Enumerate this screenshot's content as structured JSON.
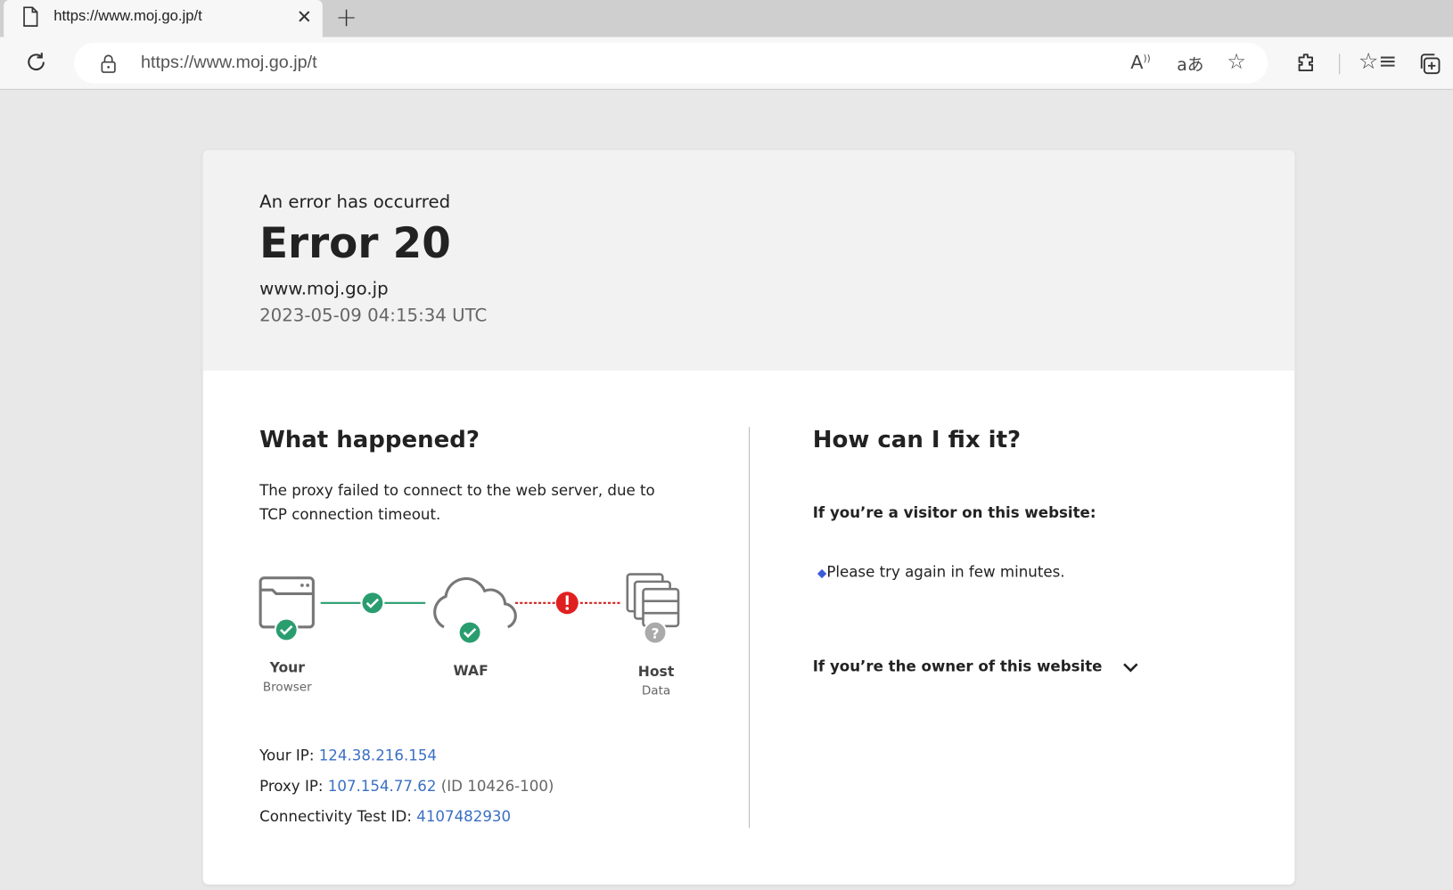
{
  "browser": {
    "tab_title": "https://www.moj.go.jp/t",
    "address": "https://www.moj.go.jp/t",
    "icons": [
      "document-icon",
      "close-icon",
      "new-tab-icon",
      "reload-icon",
      "lock-icon",
      "read-aloud-icon",
      "translate-icon",
      "add-favorite-icon",
      "extensions-icon",
      "favorites-icon",
      "collections-icon"
    ]
  },
  "header": {
    "subtitle": "An error has occurred",
    "error": "Error 20",
    "domain": "www.moj.go.jp",
    "timestamp": "2023-05-09 04:15:34 UTC"
  },
  "what": {
    "title": "What happened?",
    "description": "The proxy failed to connect to the web server, due to TCP connection timeout.",
    "diagram": {
      "browser": {
        "label": "Your",
        "sub": "Browser",
        "status": "ok"
      },
      "waf": {
        "label": "WAF",
        "status": "ok"
      },
      "host": {
        "label": "Host",
        "sub": "Data",
        "status": "unknown"
      },
      "link1": "ok",
      "link2": "error"
    },
    "your_ip_label": "Your IP: ",
    "your_ip": "124.38.216.154",
    "proxy_ip_label": "Proxy IP: ",
    "proxy_ip": "107.154.77.62",
    "proxy_id": "(ID 10426-100)",
    "test_id_label": "Connectivity Test ID: ",
    "test_id": "4107482930"
  },
  "fix": {
    "title": "How can I fix it?",
    "visitor_heading": "If you’re a visitor on this website:",
    "visitor_tip": "Please try again in few minutes.",
    "owner_heading": "If you’re the owner of this website"
  },
  "colors": {
    "ok": "#2a9d6f",
    "error": "#e02020",
    "unknown": "#aaaaaa",
    "link": "#3a6fc4",
    "bullet": "#3b5bdb"
  }
}
